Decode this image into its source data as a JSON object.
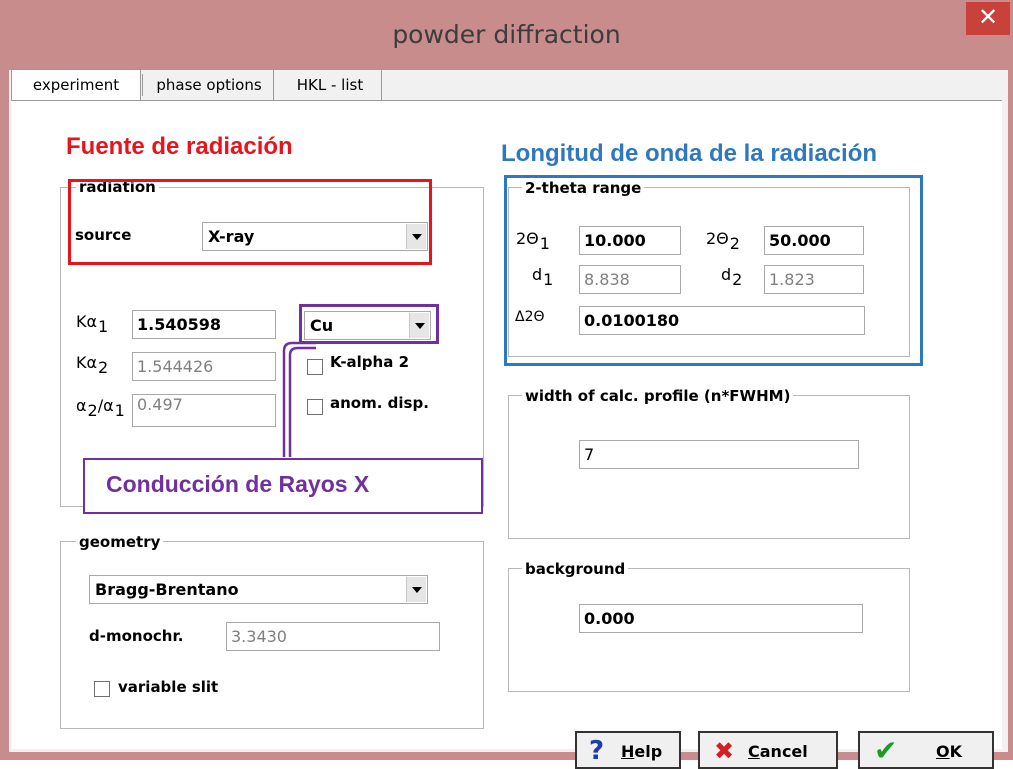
{
  "window": {
    "title": "powder diffraction",
    "close_glyph": "✕"
  },
  "tabs": [
    {
      "label": "experiment",
      "active": true
    },
    {
      "label": "phase options",
      "active": false
    },
    {
      "label": "HKL - list",
      "active": false
    }
  ],
  "annotations": {
    "source_note": {
      "text": "Fuente de radiación",
      "color": "#e8141c"
    },
    "wavelength_note": {
      "text": "Longitud de onda de la radiación",
      "color": "#2f78c0"
    },
    "xray_note": {
      "text": "Conducción de Rayos X",
      "color": "#7030a0"
    }
  },
  "radiation": {
    "group_label": "radiation",
    "source_label": "source",
    "source_value": "X-ray",
    "ka1_symbol": "Kα",
    "ka1_sub": "1",
    "ka1_value": "1.540598",
    "ka2_symbol": "Kα",
    "ka2_sub": "2",
    "ka2_value": "1.544426",
    "ratio_symbol": "α",
    "ratio_sub_a": "2",
    "ratio_slash": "/α",
    "ratio_sub_b": "1",
    "ratio_value": "0.497",
    "anode_value": "Cu",
    "kalpha2_label": "K-alpha 2",
    "kalpha2_checked": false,
    "anom_label": "anom. disp.",
    "anom_checked": false
  },
  "two_theta": {
    "group_label": "2-theta range",
    "t1_symbol": "2Θ",
    "t1_sub": "1",
    "t1_value": "10.000",
    "t2_symbol": "2Θ",
    "t2_sub": "2",
    "t2_value": "50.000",
    "d1_symbol": "d",
    "d1_sub": "1",
    "d1_value": "8.838",
    "d2_symbol": "d",
    "d2_sub": "2",
    "d2_value": "1.823",
    "step_symbol": "Δ2Θ",
    "step_value": "0.0100180"
  },
  "profile": {
    "group_label": "width of calc. profile  (n*FWHM)",
    "value": "7"
  },
  "geometry": {
    "group_label": "geometry",
    "value": "Bragg-Brentano",
    "monochr_label": "d-monochr.",
    "monochr_value": "3.3430",
    "slit_label": "variable slit",
    "slit_checked": false
  },
  "background": {
    "group_label": "background",
    "value": "0.000"
  },
  "buttons": {
    "help": {
      "icon": "?",
      "pre": "",
      "mnemonic": "H",
      "rest": "elp"
    },
    "cancel": {
      "icon": "✖",
      "pre": "",
      "mnemonic": "C",
      "rest": "ancel"
    },
    "ok": {
      "icon": "✔",
      "pre": "",
      "mnemonic": "O",
      "rest": "K"
    }
  },
  "colors": {
    "titlebar": "#c98c8c",
    "close": "#c8413a",
    "source_box": "#e8141c",
    "wavelength_box": "#2f78c0",
    "xray_box": "#7030a0"
  }
}
